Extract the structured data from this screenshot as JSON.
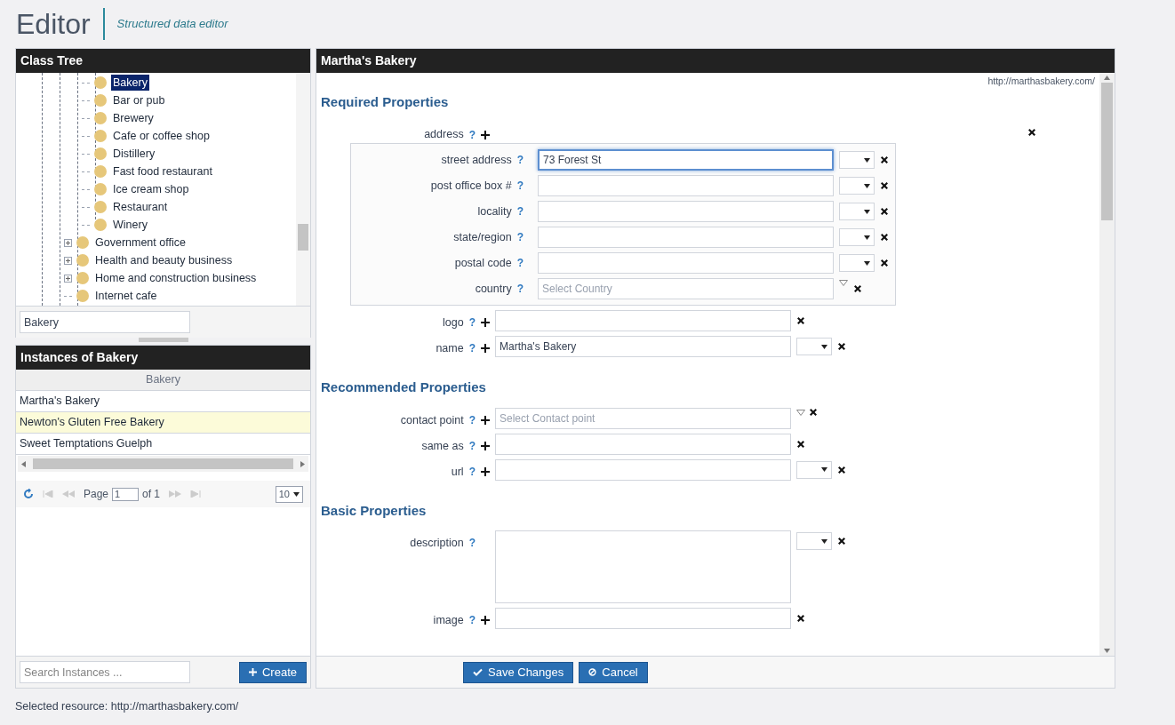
{
  "header": {
    "title": "Editor",
    "subtitle": "Structured data editor"
  },
  "class_tree": {
    "title": "Class Tree",
    "items": [
      {
        "children": [
          {
            "label": "Bakery",
            "selected": true
          },
          {
            "label": "Bar or pub",
            "selected": false
          },
          {
            "label": "Brewery",
            "selected": false
          },
          {
            "label": "Cafe or coffee shop",
            "selected": false
          },
          {
            "label": "Distillery",
            "selected": false
          },
          {
            "label": "Fast food restaurant",
            "selected": false
          },
          {
            "label": "Ice cream shop",
            "selected": false
          },
          {
            "label": "Restaurant",
            "selected": false
          },
          {
            "label": "Winery",
            "selected": false
          }
        ]
      },
      {
        "label": "Government office",
        "selected": false,
        "expandable": true
      },
      {
        "label": "Health and beauty business",
        "selected": false,
        "expandable": true
      },
      {
        "label": "Home and construction business",
        "selected": false,
        "expandable": true
      },
      {
        "label": "Internet cafe",
        "selected": false,
        "expandable": false
      }
    ],
    "filter": {
      "value": "Bakery"
    }
  },
  "instances": {
    "title": "Instances of Bakery",
    "column": "Bakery",
    "rows": [
      {
        "name": "Martha's Bakery",
        "highlighted": false
      },
      {
        "name": "Newton's Gluten Free Bakery",
        "highlighted": true
      },
      {
        "name": "Sweet Temptations Guelph",
        "highlighted": false
      }
    ],
    "pager": {
      "page_label": "Page",
      "page": "1",
      "of": "of 1",
      "page_size": "10"
    },
    "search": {
      "placeholder": "Search Instances ..."
    },
    "create": "Create"
  },
  "editor": {
    "title": "Martha's Bakery",
    "url": "http://marthasbakery.com/",
    "sections": [
      {
        "title": "Required Properties",
        "properties": [
          {
            "label": "address",
            "help": "?",
            "addable": true,
            "kind": "group",
            "fields": [
              {
                "label": "street address",
                "help": "?",
                "kind": "text",
                "value": "73 Forest St",
                "focused": true,
                "lang": true
              },
              {
                "label": "post office box #",
                "help": "?",
                "kind": "text",
                "focused": false,
                "lang": true
              },
              {
                "label": "locality",
                "help": "?",
                "kind": "text",
                "focused": false,
                "lang": true
              },
              {
                "label": "state/region",
                "help": "?",
                "kind": "text",
                "focused": false,
                "lang": true
              },
              {
                "label": "postal code",
                "help": "?",
                "kind": "text",
                "focused": false,
                "lang": true
              },
              {
                "label": "country",
                "help": "?",
                "kind": "select",
                "placeholder": "Select Country",
                "lang": false
              }
            ]
          },
          {
            "label": "logo",
            "help": "?",
            "addable": true,
            "kind": "text",
            "lang": false
          },
          {
            "label": "name",
            "help": "?",
            "addable": true,
            "kind": "text",
            "value": "Martha's Bakery",
            "lang": true
          }
        ]
      },
      {
        "title": "Recommended Properties",
        "properties": [
          {
            "label": "contact point",
            "help": "?",
            "addable": true,
            "kind": "select",
            "placeholder": "Select Contact point",
            "lang": false
          },
          {
            "label": "same as",
            "help": "?",
            "addable": true,
            "kind": "text",
            "lang": false
          },
          {
            "label": "url",
            "help": "?",
            "addable": true,
            "kind": "text",
            "lang": true
          }
        ]
      },
      {
        "title": "Basic Properties",
        "properties": [
          {
            "label": "description",
            "help": "?",
            "addable": false,
            "kind": "textarea",
            "lang": true
          },
          {
            "label": "image",
            "help": "?",
            "addable": true,
            "kind": "text",
            "lang": false
          }
        ]
      }
    ],
    "buttons": [
      {
        "label": "Save Changes",
        "kind": "save"
      },
      {
        "label": "Cancel",
        "kind": "cancel"
      }
    ]
  },
  "status_bar": "Selected resource: http://marthasbakery.com/"
}
